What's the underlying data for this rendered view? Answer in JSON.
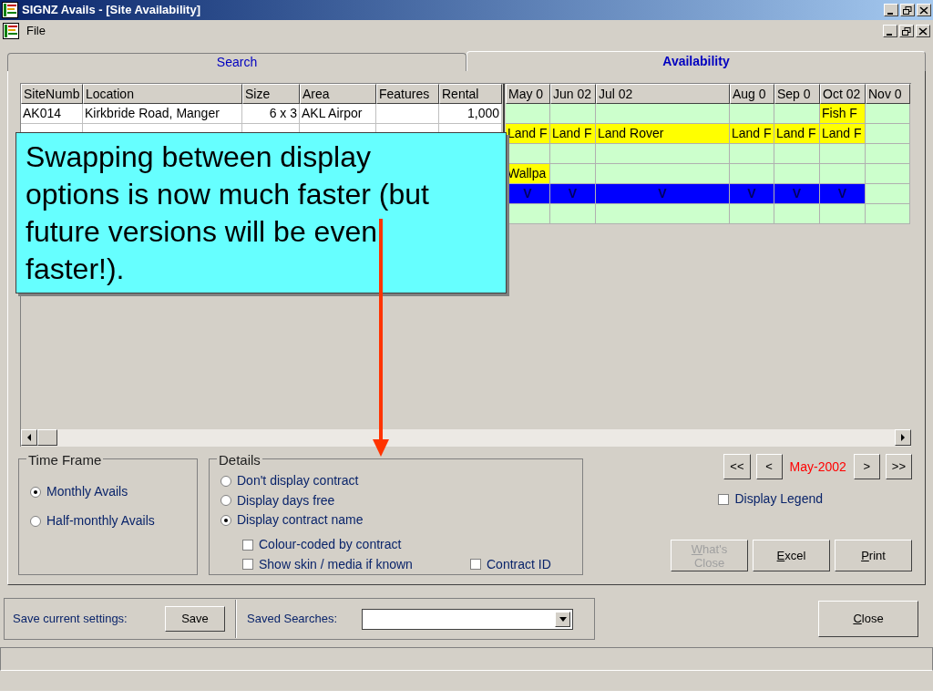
{
  "window": {
    "title": "SIGNZ Avails - [Site Availability]"
  },
  "menu": [
    "File"
  ],
  "tabs": [
    {
      "label": "Search",
      "selected": false
    },
    {
      "label": "Availability",
      "selected": true
    }
  ],
  "table": {
    "columns": [
      "SiteNumb",
      "Location",
      "Size",
      "Area",
      "Features",
      "Rental"
    ],
    "rows": [
      {
        "site": "AK014",
        "location": "Kirkbride Road, Manger",
        "size": "6 x 3",
        "area": "AKL Airpor",
        "rental": "1,000"
      }
    ]
  },
  "months": [
    "May 0",
    "Jun 02",
    "Jul 02",
    "Aug 0",
    "Sep 0",
    "Oct 02",
    "Nov 0"
  ],
  "availability": [
    [
      {
        "kind": "free"
      },
      {
        "kind": "free"
      },
      {
        "kind": "free"
      },
      {
        "kind": "free"
      },
      {
        "kind": "free"
      },
      {
        "kind": "booked",
        "text": "Fish F"
      },
      {
        "kind": "free"
      }
    ],
    [
      {
        "kind": "booked",
        "text": "Land F"
      },
      {
        "kind": "booked",
        "text": "Land F"
      },
      {
        "kind": "booked",
        "text": "Land Rover"
      },
      {
        "kind": "booked",
        "text": "Land F"
      },
      {
        "kind": "booked",
        "text": "Land F"
      },
      {
        "kind": "booked",
        "text": "Land F"
      },
      {
        "kind": "free"
      }
    ],
    [
      {
        "kind": "free"
      },
      {
        "kind": "free"
      },
      {
        "kind": "free"
      },
      {
        "kind": "free"
      },
      {
        "kind": "free"
      },
      {
        "kind": "free"
      },
      {
        "kind": "free"
      }
    ],
    [
      {
        "kind": "booked",
        "text": "Wallpa"
      },
      {
        "kind": "free"
      },
      {
        "kind": "free"
      },
      {
        "kind": "free"
      },
      {
        "kind": "free"
      },
      {
        "kind": "free"
      },
      {
        "kind": "free"
      }
    ],
    [
      {
        "kind": "vacant",
        "text": "V"
      },
      {
        "kind": "vacant",
        "text": "V"
      },
      {
        "kind": "vacant",
        "text": "V"
      },
      {
        "kind": "vacant",
        "text": "V"
      },
      {
        "kind": "vacant",
        "text": "V"
      },
      {
        "kind": "vacant",
        "text": "V"
      },
      {
        "kind": "free"
      }
    ],
    [
      {
        "kind": "free"
      },
      {
        "kind": "free"
      },
      {
        "kind": "free"
      },
      {
        "kind": "free"
      },
      {
        "kind": "free"
      },
      {
        "kind": "free"
      },
      {
        "kind": "free"
      }
    ]
  ],
  "time_frame": {
    "title": "Time Frame",
    "options": [
      {
        "label": "Monthly Avails",
        "selected": true
      },
      {
        "label": "Half-monthly Avails",
        "selected": false
      }
    ]
  },
  "details": {
    "title": "Details",
    "options": [
      {
        "label": "Don't display contract",
        "selected": false
      },
      {
        "label": "Display days free",
        "selected": false
      },
      {
        "label": "Display contract name",
        "selected": true
      }
    ],
    "checkboxes": [
      {
        "label": "Colour-coded by contract",
        "checked": false
      },
      {
        "label": "Show skin / media if known",
        "checked": false
      },
      {
        "label": "Contract ID",
        "checked": false
      }
    ]
  },
  "navigation": {
    "back": [
      "<<",
      "<"
    ],
    "current": "May-2002",
    "forward": [
      ">",
      ">>"
    ]
  },
  "legend": {
    "label": "Display Legend",
    "checked": false
  },
  "actions": [
    {
      "label": "What's Close",
      "disabled": true
    },
    {
      "label": "Excel",
      "disabled": false
    },
    {
      "label": "Print",
      "disabled": false
    }
  ],
  "save_bar": {
    "label": "Save current settings:",
    "button": "Save",
    "saved_label": "Saved Searches:"
  },
  "close": {
    "label": "Close"
  },
  "callout": {
    "text": "Swapping between display options is now much faster (but future versions will be even faster!)."
  }
}
